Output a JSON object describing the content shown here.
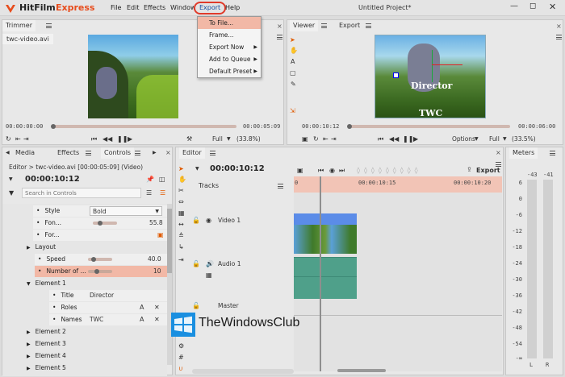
{
  "app": {
    "logo_text": "HitFilm",
    "logo_sub": "Express",
    "project_title": "Untitled Project*"
  },
  "menu": [
    "File",
    "Edit",
    "Effects",
    "Window",
    "Export",
    "Help"
  ],
  "export_menu": [
    {
      "label": "To File...",
      "submenu": false,
      "highlight": true
    },
    {
      "label": "Frame...",
      "submenu": false,
      "highlight": false
    },
    {
      "label": "Export Now",
      "submenu": true,
      "highlight": false
    },
    {
      "label": "Add to Queue",
      "submenu": true,
      "highlight": false
    },
    {
      "label": "Default Preset",
      "submenu": true,
      "highlight": false
    }
  ],
  "trimmer": {
    "tab": "Trimmer",
    "file": "twc-video.avi",
    "tc_start": "00:00:00:00",
    "tc_end": "00:00:05:09",
    "quality": "Full",
    "zoom": "(33.8%)"
  },
  "viewer": {
    "tab_viewer": "Viewer",
    "tab_export": "Export",
    "tc_start": "00:00:10:12",
    "tc_end": "00:00:06:00",
    "options": "Options",
    "quality": "Full",
    "zoom": "(33.5%)",
    "overlay_director": "Director",
    "overlay_twc": "TWC"
  },
  "controls": {
    "tabs": [
      "Media",
      "Effects",
      "Controls"
    ],
    "breadcrumb": "Editor > twc-video.avi [00:00:05:09] (Video)",
    "timecode": "00:00:10:12",
    "search_placeholder": "Search in Controls",
    "rows": [
      {
        "label": "Style",
        "value": "Bold",
        "indent": 2,
        "kind": "prop"
      },
      {
        "label": "Fon...",
        "value": "55.8",
        "indent": 2,
        "kind": "prop"
      },
      {
        "label": "For...",
        "value": "",
        "indent": 2,
        "kind": "prop"
      },
      {
        "label": "Layout",
        "value": "",
        "indent": 1,
        "kind": "group"
      },
      {
        "label": "Speed",
        "value": "40.0",
        "indent": 1,
        "kind": "prop"
      },
      {
        "label": "Number of ...",
        "value": "10",
        "indent": 1,
        "kind": "prop"
      },
      {
        "label": "Element 1",
        "value": "",
        "indent": 0,
        "kind": "group"
      },
      {
        "label": "Title",
        "value": "Director",
        "indent": 2,
        "kind": "prop"
      },
      {
        "label": "Roles",
        "value": "",
        "indent": 2,
        "kind": "prop"
      },
      {
        "label": "Names",
        "value": "TWC",
        "indent": 2,
        "kind": "prop"
      },
      {
        "label": "Element 2",
        "value": "",
        "indent": 0,
        "kind": "group"
      },
      {
        "label": "Element 3",
        "value": "",
        "indent": 0,
        "kind": "group"
      },
      {
        "label": "Element 4",
        "value": "",
        "indent": 0,
        "kind": "group"
      },
      {
        "label": "Element 5",
        "value": "",
        "indent": 0,
        "kind": "group"
      }
    ]
  },
  "editor": {
    "tab": "Editor",
    "timecode": "00:00:10:12",
    "export_label": "Export",
    "tracks_label": "Tracks",
    "ruler": [
      "0",
      "00:00:10:15",
      "00:00:10:20"
    ],
    "video_track": "Video 1",
    "audio_track": "Audio 1",
    "master_track": "Master"
  },
  "meters": {
    "tab": "Meters",
    "top_left": "-43",
    "top_right": "-41",
    "scale": [
      "6",
      "0",
      "-6",
      "-12",
      "-18",
      "-24",
      "-30",
      "-36",
      "-42",
      "-48",
      "-54",
      "-∞"
    ],
    "ch_left": "L",
    "ch_right": "R"
  },
  "watermark": "TheWindowsClub",
  "colors": {
    "accent": "#e03a2a",
    "highlight": "#f2b8a6",
    "video_track": "#5b8ce8",
    "audio_track": "#4fa08a",
    "win_logo": "#1a8fe0"
  }
}
